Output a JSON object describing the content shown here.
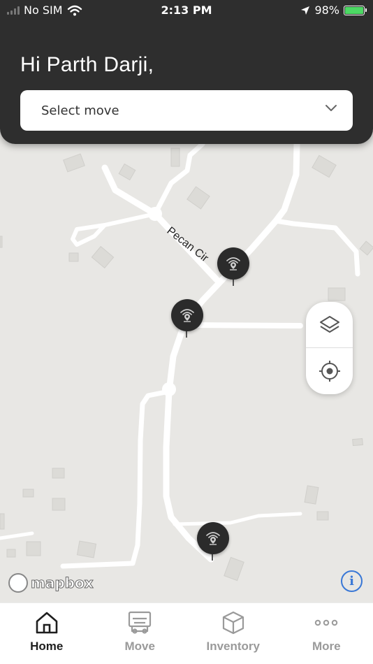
{
  "status_bar": {
    "carrier": "No SIM",
    "time": "2:13 PM",
    "battery": "98%"
  },
  "header": {
    "greeting": "Hi Parth Darji,"
  },
  "move_select": {
    "value": "Select move"
  },
  "map": {
    "street_label": "Pecan Cir",
    "attribution": "mapbox"
  },
  "tabs": [
    {
      "label": "Home",
      "icon": "home-icon",
      "active": true
    },
    {
      "label": "Move",
      "icon": "truck-icon",
      "active": false
    },
    {
      "label": "Inventory",
      "icon": "box-icon",
      "active": false
    },
    {
      "label": "More",
      "icon": "more-icon",
      "active": false
    }
  ],
  "colors": {
    "header_bg": "#2e2e2e",
    "marker_bg": "#2b2b2b",
    "info_blue": "#3a78d6",
    "battery_green": "#4cd964"
  }
}
